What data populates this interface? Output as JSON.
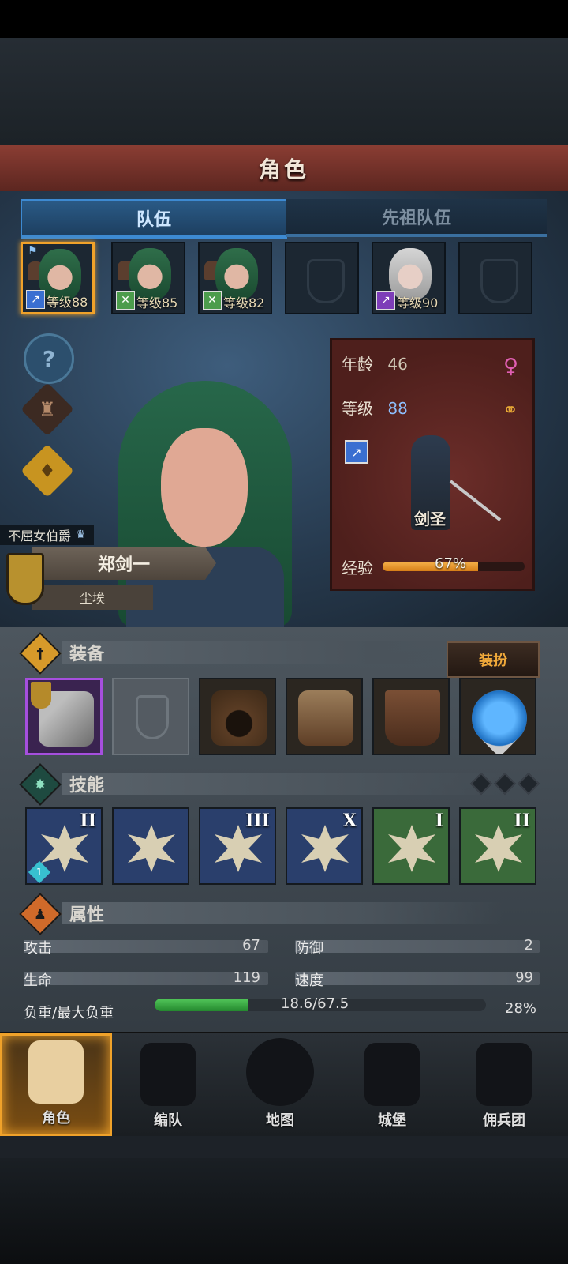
{
  "header": {
    "title": "角色"
  },
  "tabs": [
    {
      "label": "队伍",
      "active": true
    },
    {
      "label": "先祖队伍",
      "active": false
    }
  ],
  "portraits": [
    {
      "level": "等级88",
      "class_icon": "sword-icon",
      "hair": "green",
      "selected": true
    },
    {
      "level": "等级85",
      "class_icon": "bow-icon",
      "hair": "green"
    },
    {
      "level": "等级82",
      "class_icon": "bow-icon",
      "hair": "green"
    },
    {
      "level": "",
      "empty": true
    },
    {
      "level": "等级90",
      "class_icon": "staff-icon",
      "hair": "white"
    },
    {
      "level": "",
      "empty": true
    }
  ],
  "hero": {
    "title": "不屈女伯爵",
    "name": "郑剑一",
    "rank": "尘埃"
  },
  "info": {
    "age_label": "年龄",
    "age_value": "46",
    "level_label": "等级",
    "level_value": "88",
    "class_name": "剑圣",
    "exp_label": "经验",
    "exp_percent": "67%",
    "exp_fraction": 0.67
  },
  "equipment": {
    "title": "装备",
    "dress_button": "装扮",
    "slots": [
      "weapon-spear-icon",
      "shield-slot-icon",
      "hood-icon",
      "fur-coat-icon",
      "boots-icon",
      "heart-amulet-icon"
    ]
  },
  "skills": {
    "title": "技能",
    "slots": [
      {
        "rank": "II",
        "gem": "1",
        "color": "blue"
      },
      {
        "rank": "",
        "color": "blue"
      },
      {
        "rank": "III",
        "color": "blue"
      },
      {
        "rank": "X",
        "color": "blue"
      },
      {
        "rank": "I",
        "color": "green"
      },
      {
        "rank": "II",
        "color": "green"
      }
    ]
  },
  "attributes": {
    "title": "属性",
    "attack_label": "攻击",
    "attack_value": "67",
    "defense_label": "防御",
    "defense_value": "2",
    "life_label": "生命",
    "life_value": "119",
    "speed_label": "速度",
    "speed_value": "99",
    "load_label": "负重/最大负重",
    "load_value": "18.6/67.5",
    "load_percent": "28%",
    "load_fraction": 0.28
  },
  "nav": [
    {
      "label": "角色",
      "active": true
    },
    {
      "label": "编队"
    },
    {
      "label": "地图"
    },
    {
      "label": "城堡"
    },
    {
      "label": "佣兵团"
    }
  ],
  "colors": {
    "accent": "#f0a22a",
    "header": "#7a332b",
    "tab_active": "#3d8ad2"
  }
}
